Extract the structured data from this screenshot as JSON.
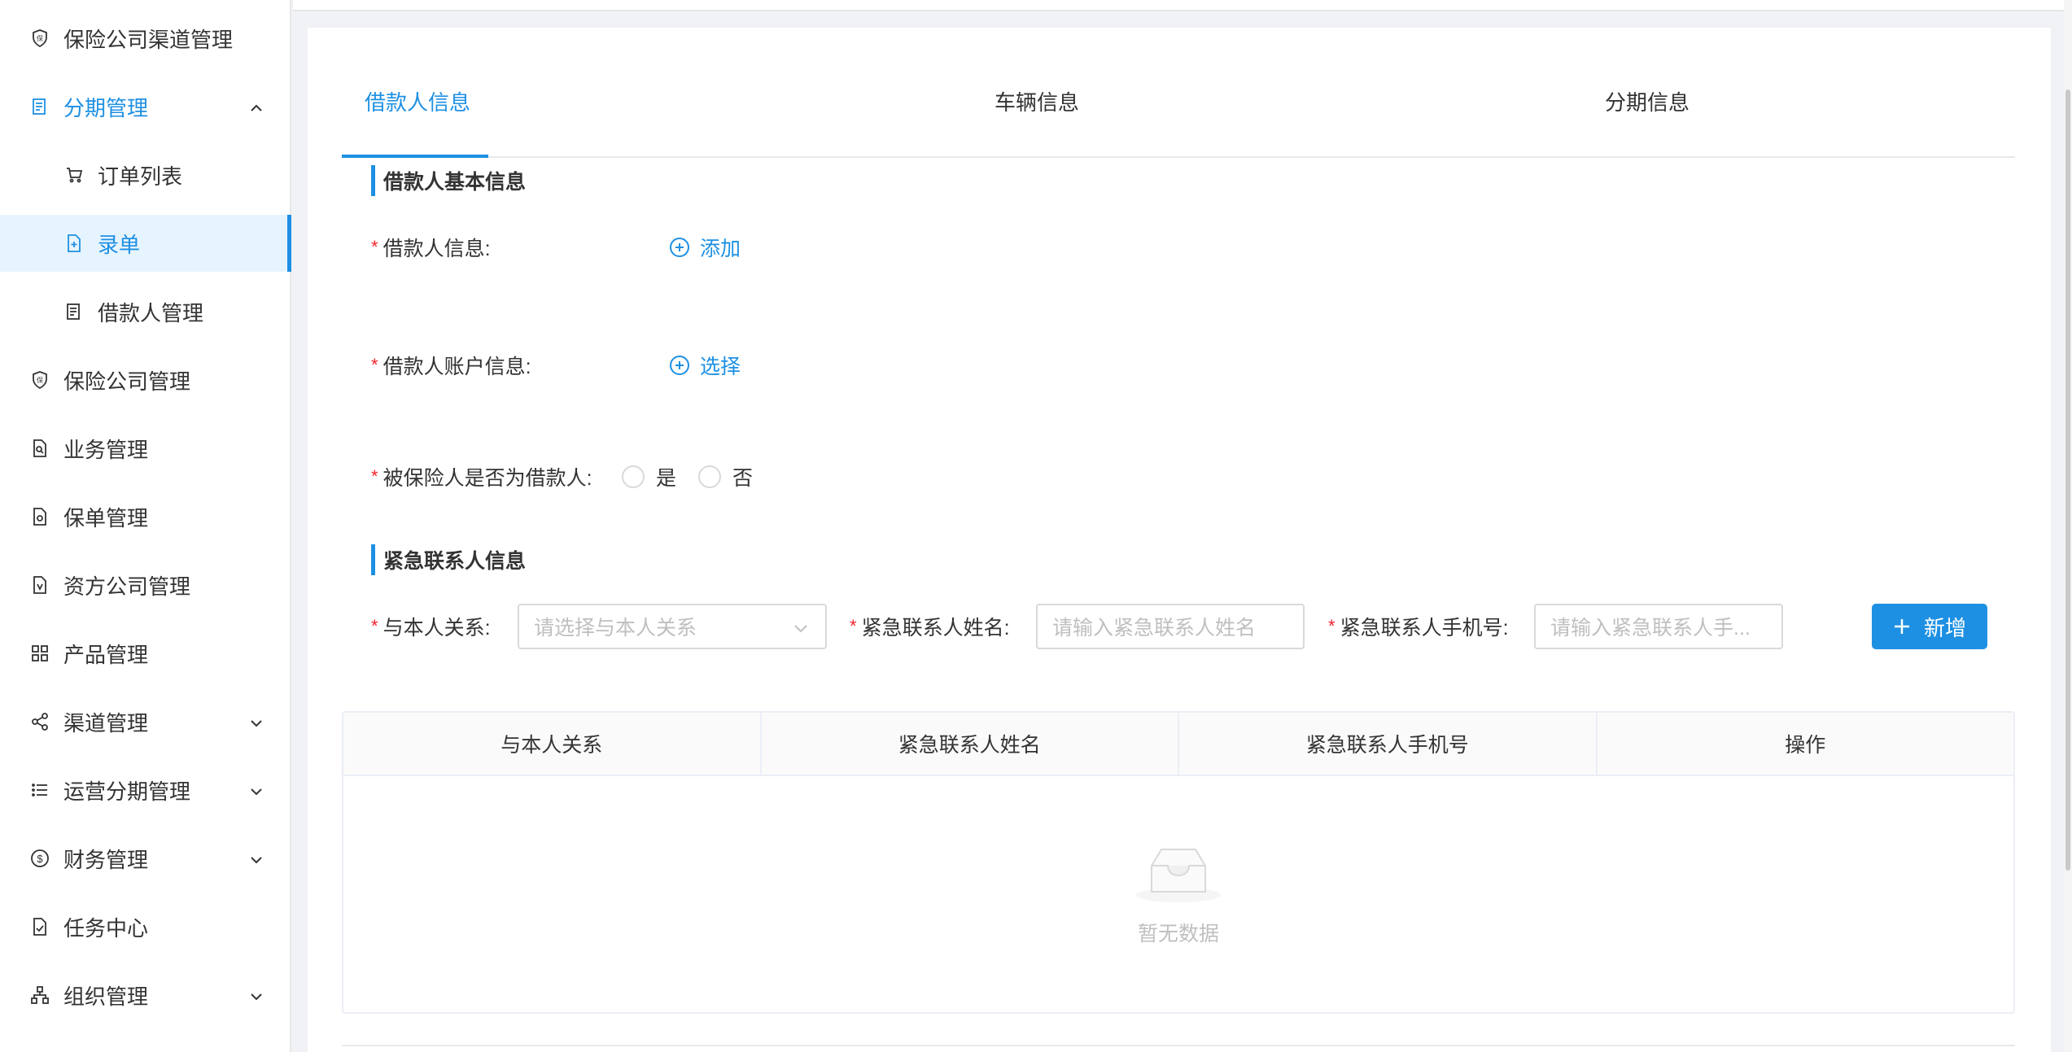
{
  "sidebar": {
    "items": [
      {
        "label": "保险公司渠道管理",
        "icon": "shield-icon"
      },
      {
        "label": "分期管理",
        "icon": "document-icon",
        "expanded": true
      },
      {
        "label": "订单列表",
        "icon": "cart-icon"
      },
      {
        "label": "录单",
        "icon": "file-add-icon",
        "selected": true
      },
      {
        "label": "借款人管理",
        "icon": "document-icon"
      },
      {
        "label": "保险公司管理",
        "icon": "shield-icon"
      },
      {
        "label": "业务管理",
        "icon": "file-search-icon"
      },
      {
        "label": "保单管理",
        "icon": "file-icon"
      },
      {
        "label": "资方公司管理",
        "icon": "file-shield-icon"
      },
      {
        "label": "产品管理",
        "icon": "grid-icon"
      },
      {
        "label": "渠道管理",
        "icon": "share-icon"
      },
      {
        "label": "运营分期管理",
        "icon": "list-icon"
      },
      {
        "label": "财务管理",
        "icon": "dollar-icon"
      },
      {
        "label": "任务中心",
        "icon": "file-check-icon"
      },
      {
        "label": "组织管理",
        "icon": "org-icon"
      }
    ]
  },
  "tabs": [
    {
      "label": "借款人信息",
      "active": true
    },
    {
      "label": "车辆信息"
    },
    {
      "label": "分期信息"
    }
  ],
  "borrower_section": {
    "title": "借款人基本信息",
    "borrower_info_label": "借款人信息:",
    "add_label": "添加",
    "account_info_label": "借款人账户信息:",
    "select_label": "选择",
    "insured_is_borrower_label": "被保险人是否为借款人:",
    "option_yes": "是",
    "option_no": "否"
  },
  "contact_section": {
    "title": "紧急联系人信息",
    "relation_label": "与本人关系:",
    "relation_placeholder": "请选择与本人关系",
    "name_label": "紧急联系人姓名:",
    "name_placeholder": "请输入紧急联系人姓名",
    "phone_label": "紧急联系人手机号:",
    "phone_placeholder": "请输入紧急联系人手...",
    "add_button": "新增"
  },
  "table": {
    "columns": [
      "与本人关系",
      "紧急联系人姓名",
      "紧急联系人手机号",
      "操作"
    ],
    "empty_text": "暂无数据"
  },
  "colors": {
    "accent": "#1e90e3",
    "required": "#f5222d"
  }
}
